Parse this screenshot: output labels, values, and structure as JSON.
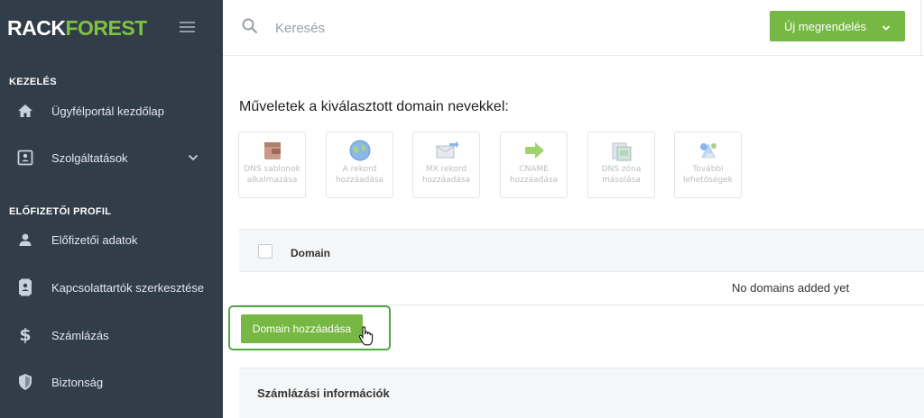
{
  "brand": {
    "part1": "RACK",
    "part2": "FOREST"
  },
  "sidebar": {
    "sections": [
      {
        "title": "KEZELÉS"
      },
      {
        "title": "ELŐFIZETŐI PROFIL"
      }
    ],
    "items": [
      {
        "label": "Ügyfélportál kezdőlap",
        "icon": "home-icon"
      },
      {
        "label": "Szolgáltatások",
        "icon": "contact-card-icon"
      },
      {
        "label": "Előfizetői adatok",
        "icon": "user-icon"
      },
      {
        "label": "Kapcsolattartók szerkesztése",
        "icon": "contacts-book-icon"
      },
      {
        "label": "Számlázás",
        "icon": "dollar-icon"
      },
      {
        "label": "Biztonság",
        "icon": "shield-icon"
      }
    ]
  },
  "topbar": {
    "search_placeholder": "Keresés",
    "new_order_label": "Új megrendelés"
  },
  "main": {
    "ops_heading": "Műveletek a kiválasztott domain nevekkel:",
    "tools": [
      {
        "line1": "DNS sablonok",
        "line2": "alkalmazása",
        "icon": "wallet-icon"
      },
      {
        "line1": "A rekord",
        "line2": "hozzáadása",
        "icon": "globe-icon"
      },
      {
        "line1": "MX rekord",
        "line2": "hozzáadása",
        "icon": "mail-icon"
      },
      {
        "line1": "CNAME",
        "line2": "hozzáadása",
        "icon": "arrow-right-icon"
      },
      {
        "line1": "DNS zóna",
        "line2": "másolása",
        "icon": "copy-icon"
      },
      {
        "line1": "További",
        "line2": "lehetőségek",
        "icon": "settings-icon"
      }
    ],
    "table": {
      "column_domain": "Domain",
      "empty_message": "No domains added yet"
    },
    "add_domain_label": "Domain hozzáadása",
    "billing_title": "Számlázási információk"
  },
  "colors": {
    "sidebar_bg": "#323d4a",
    "accent_green": "#76b843",
    "highlight_border": "#4ea842"
  }
}
